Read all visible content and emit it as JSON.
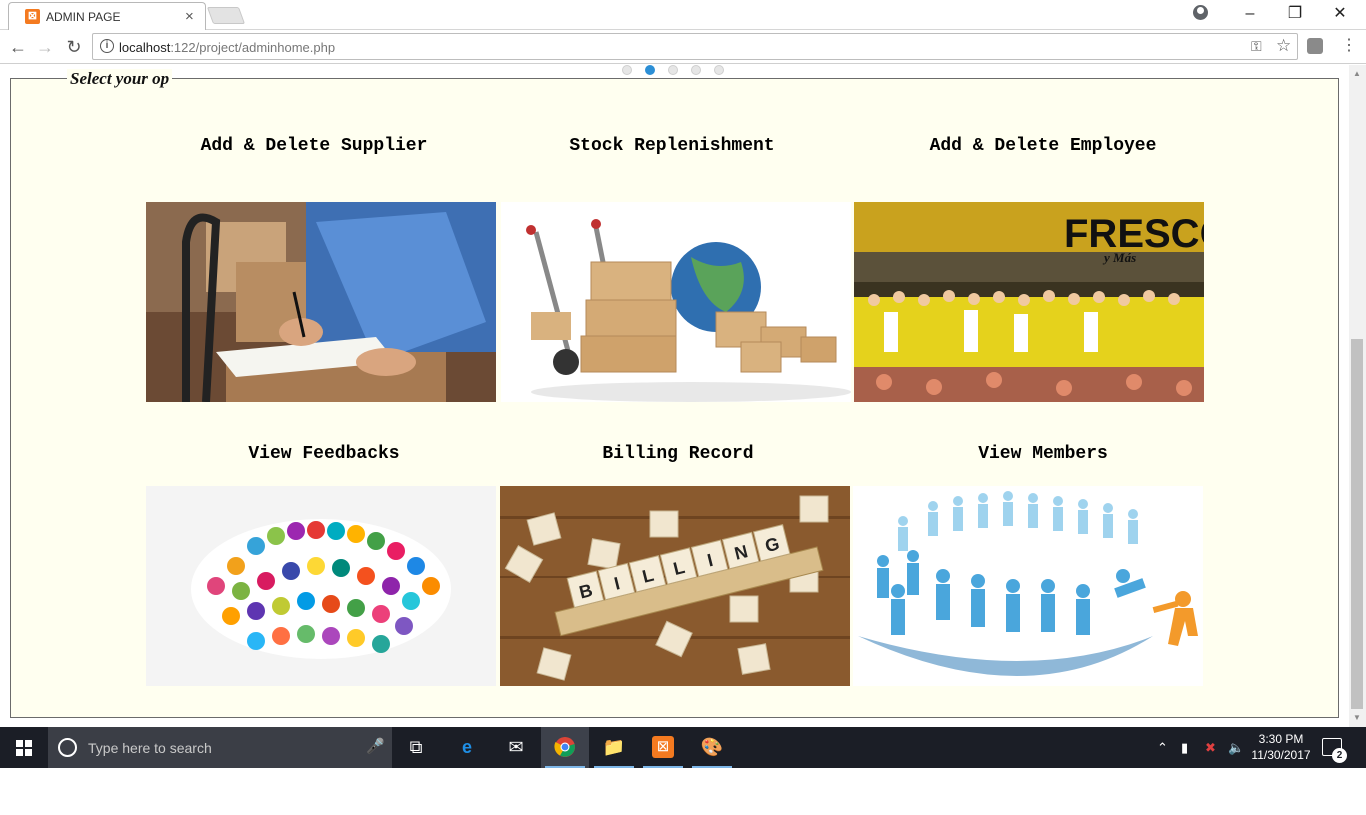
{
  "browser": {
    "tab_title": "ADMIN PAGE",
    "tab_close": "×",
    "url_host": "localhost",
    "url_path": ":122/project/adminhome.php",
    "info_glyph": "i"
  },
  "page": {
    "legend": "Select your op",
    "cards": [
      {
        "title": "Add & Delete Supplier",
        "image": "supplier-photo"
      },
      {
        "title": "Stock Replenishment",
        "image": "stock-photo"
      },
      {
        "title": "Add & Delete Employee",
        "image": "employee-photo"
      },
      {
        "title": "View Feedbacks",
        "image": "feedback-photo"
      },
      {
        "title": "Billing Record",
        "image": "billing-photo"
      },
      {
        "title": "View Members",
        "image": "members-photo"
      }
    ],
    "employee_sign": "FRESCO",
    "employee_sign_sub": "y Más",
    "billing_tiles": [
      "B",
      "I",
      "L",
      "L",
      "I",
      "N",
      "G"
    ],
    "slider_dots": 5,
    "slider_active": 2
  },
  "taskbar": {
    "search_placeholder": "Type here to search",
    "time": "3:30 PM",
    "date": "11/30/2017",
    "notification_count": "2"
  },
  "colors": {
    "page_bg": "#fffff0",
    "slider_active": "#2c8fd6",
    "taskbar": "#1b1e26"
  }
}
